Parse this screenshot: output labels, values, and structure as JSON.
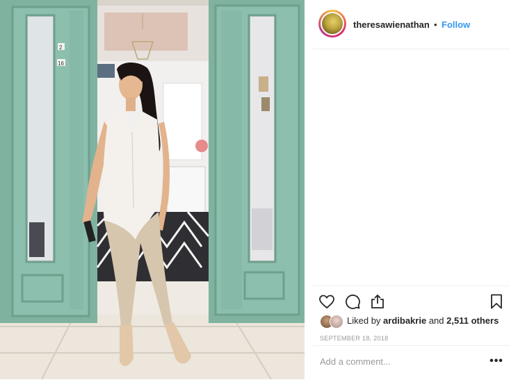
{
  "post": {
    "username": "theresawienathan",
    "separator": "•",
    "follow_label": "Follow"
  },
  "actions": {
    "like_icon": "heart-icon",
    "comment_icon": "comment-icon",
    "share_icon": "share-icon",
    "save_icon": "bookmark-icon"
  },
  "likes": {
    "prefix": "Liked by",
    "user": "ardibakrie",
    "middle": "and",
    "others": "2,511 others"
  },
  "date": "September 18, 2018",
  "comment": {
    "placeholder": "Add a comment...",
    "more_label": "•••"
  },
  "photo": {
    "door_numbers": [
      "2",
      "16"
    ]
  },
  "colors": {
    "link": "#3897f0",
    "text": "#262626",
    "muted": "#999999",
    "door_green": "#7fb3a0"
  }
}
